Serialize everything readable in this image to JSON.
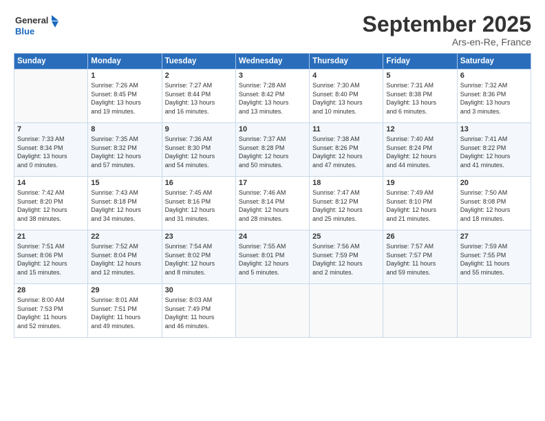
{
  "header": {
    "logo_line1": "General",
    "logo_line2": "Blue",
    "month": "September 2025",
    "location": "Ars-en-Re, France"
  },
  "days_of_week": [
    "Sunday",
    "Monday",
    "Tuesday",
    "Wednesday",
    "Thursday",
    "Friday",
    "Saturday"
  ],
  "weeks": [
    [
      {
        "num": "",
        "info": ""
      },
      {
        "num": "1",
        "info": "Sunrise: 7:26 AM\nSunset: 8:45 PM\nDaylight: 13 hours\nand 19 minutes."
      },
      {
        "num": "2",
        "info": "Sunrise: 7:27 AM\nSunset: 8:44 PM\nDaylight: 13 hours\nand 16 minutes."
      },
      {
        "num": "3",
        "info": "Sunrise: 7:28 AM\nSunset: 8:42 PM\nDaylight: 13 hours\nand 13 minutes."
      },
      {
        "num": "4",
        "info": "Sunrise: 7:30 AM\nSunset: 8:40 PM\nDaylight: 13 hours\nand 10 minutes."
      },
      {
        "num": "5",
        "info": "Sunrise: 7:31 AM\nSunset: 8:38 PM\nDaylight: 13 hours\nand 6 minutes."
      },
      {
        "num": "6",
        "info": "Sunrise: 7:32 AM\nSunset: 8:36 PM\nDaylight: 13 hours\nand 3 minutes."
      }
    ],
    [
      {
        "num": "7",
        "info": "Sunrise: 7:33 AM\nSunset: 8:34 PM\nDaylight: 13 hours\nand 0 minutes."
      },
      {
        "num": "8",
        "info": "Sunrise: 7:35 AM\nSunset: 8:32 PM\nDaylight: 12 hours\nand 57 minutes."
      },
      {
        "num": "9",
        "info": "Sunrise: 7:36 AM\nSunset: 8:30 PM\nDaylight: 12 hours\nand 54 minutes."
      },
      {
        "num": "10",
        "info": "Sunrise: 7:37 AM\nSunset: 8:28 PM\nDaylight: 12 hours\nand 50 minutes."
      },
      {
        "num": "11",
        "info": "Sunrise: 7:38 AM\nSunset: 8:26 PM\nDaylight: 12 hours\nand 47 minutes."
      },
      {
        "num": "12",
        "info": "Sunrise: 7:40 AM\nSunset: 8:24 PM\nDaylight: 12 hours\nand 44 minutes."
      },
      {
        "num": "13",
        "info": "Sunrise: 7:41 AM\nSunset: 8:22 PM\nDaylight: 12 hours\nand 41 minutes."
      }
    ],
    [
      {
        "num": "14",
        "info": "Sunrise: 7:42 AM\nSunset: 8:20 PM\nDaylight: 12 hours\nand 38 minutes."
      },
      {
        "num": "15",
        "info": "Sunrise: 7:43 AM\nSunset: 8:18 PM\nDaylight: 12 hours\nand 34 minutes."
      },
      {
        "num": "16",
        "info": "Sunrise: 7:45 AM\nSunset: 8:16 PM\nDaylight: 12 hours\nand 31 minutes."
      },
      {
        "num": "17",
        "info": "Sunrise: 7:46 AM\nSunset: 8:14 PM\nDaylight: 12 hours\nand 28 minutes."
      },
      {
        "num": "18",
        "info": "Sunrise: 7:47 AM\nSunset: 8:12 PM\nDaylight: 12 hours\nand 25 minutes."
      },
      {
        "num": "19",
        "info": "Sunrise: 7:49 AM\nSunset: 8:10 PM\nDaylight: 12 hours\nand 21 minutes."
      },
      {
        "num": "20",
        "info": "Sunrise: 7:50 AM\nSunset: 8:08 PM\nDaylight: 12 hours\nand 18 minutes."
      }
    ],
    [
      {
        "num": "21",
        "info": "Sunrise: 7:51 AM\nSunset: 8:06 PM\nDaylight: 12 hours\nand 15 minutes."
      },
      {
        "num": "22",
        "info": "Sunrise: 7:52 AM\nSunset: 8:04 PM\nDaylight: 12 hours\nand 12 minutes."
      },
      {
        "num": "23",
        "info": "Sunrise: 7:54 AM\nSunset: 8:02 PM\nDaylight: 12 hours\nand 8 minutes."
      },
      {
        "num": "24",
        "info": "Sunrise: 7:55 AM\nSunset: 8:01 PM\nDaylight: 12 hours\nand 5 minutes."
      },
      {
        "num": "25",
        "info": "Sunrise: 7:56 AM\nSunset: 7:59 PM\nDaylight: 12 hours\nand 2 minutes."
      },
      {
        "num": "26",
        "info": "Sunrise: 7:57 AM\nSunset: 7:57 PM\nDaylight: 11 hours\nand 59 minutes."
      },
      {
        "num": "27",
        "info": "Sunrise: 7:59 AM\nSunset: 7:55 PM\nDaylight: 11 hours\nand 55 minutes."
      }
    ],
    [
      {
        "num": "28",
        "info": "Sunrise: 8:00 AM\nSunset: 7:53 PM\nDaylight: 11 hours\nand 52 minutes."
      },
      {
        "num": "29",
        "info": "Sunrise: 8:01 AM\nSunset: 7:51 PM\nDaylight: 11 hours\nand 49 minutes."
      },
      {
        "num": "30",
        "info": "Sunrise: 8:03 AM\nSunset: 7:49 PM\nDaylight: 11 hours\nand 46 minutes."
      },
      {
        "num": "",
        "info": ""
      },
      {
        "num": "",
        "info": ""
      },
      {
        "num": "",
        "info": ""
      },
      {
        "num": "",
        "info": ""
      }
    ]
  ]
}
